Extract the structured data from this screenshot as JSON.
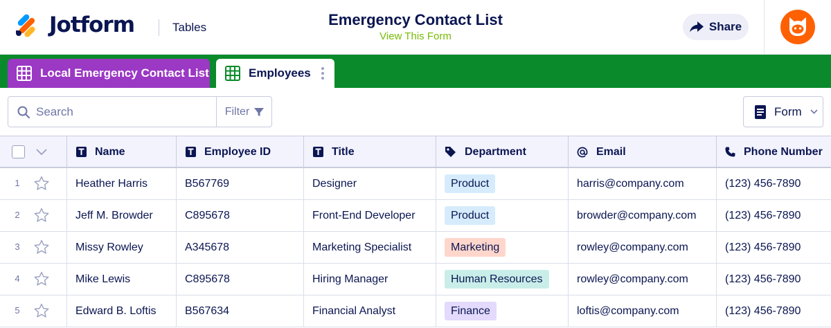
{
  "header": {
    "logo_text": "Jotform",
    "tables_link": "Tables",
    "form_title": "Emergency Contact List",
    "view_form_link": "View This Form",
    "share_label": "Share"
  },
  "tabs": [
    {
      "label": "Local Emergency Contact List",
      "color": "#9b38c4",
      "active": false
    },
    {
      "label": "Employees",
      "color": "#ffffff",
      "active": true
    }
  ],
  "tabbar_color": "#0a8a2a",
  "toolbar": {
    "search_placeholder": "Search",
    "filter_label": "Filter",
    "form_label": "Form"
  },
  "table": {
    "columns": [
      {
        "label": "Name",
        "icon": "text-type-icon"
      },
      {
        "label": "Employee ID",
        "icon": "text-type-icon"
      },
      {
        "label": "Title",
        "icon": "text-type-icon"
      },
      {
        "label": "Department",
        "icon": "tag-icon"
      },
      {
        "label": "Email",
        "icon": "at-sign-icon"
      },
      {
        "label": "Phone Number",
        "icon": "phone-icon"
      }
    ],
    "rows": [
      {
        "num": "1",
        "name": "Heather Harris",
        "employee_id": "B567769",
        "title": "Designer",
        "department": "Product",
        "dept_color": "#d6ecfc",
        "email": "harris@company.com",
        "phone": "(123) 456-7890"
      },
      {
        "num": "2",
        "name": "Jeff M. Browder",
        "employee_id": "C895678",
        "title": "Front-End Developer",
        "department": "Product",
        "dept_color": "#d6ecfc",
        "email": "browder@company.com",
        "phone": "(123) 456-7890"
      },
      {
        "num": "3",
        "name": "Missy Rowley",
        "employee_id": "A345678",
        "title": "Marketing Specialist",
        "department": "Marketing",
        "dept_color": "#ffd6cc",
        "email": "rowley@company.com",
        "phone": "(123) 456-7890"
      },
      {
        "num": "4",
        "name": "Mike Lewis",
        "employee_id": "C895678",
        "title": "Hiring Manager",
        "department": "Human Resources",
        "dept_color": "#c9eee9",
        "email": "rowley@company.com",
        "phone": "(123) 456-7890"
      },
      {
        "num": "5",
        "name": "Edward B. Loftis",
        "employee_id": "B567634",
        "title": "Financial Analyst",
        "department": "Finance",
        "dept_color": "#e3dafd",
        "email": "loftis@company.com",
        "phone": "(123) 456-7890"
      }
    ]
  }
}
